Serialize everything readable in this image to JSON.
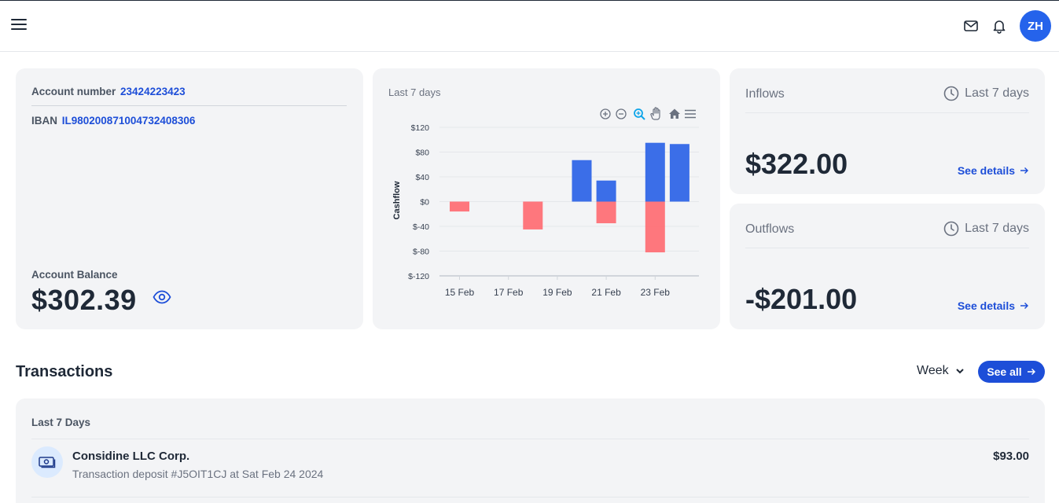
{
  "header": {
    "menu_icon": "hamburger-menu-icon",
    "mail_icon": "mail-icon",
    "bell_icon": "bell-icon",
    "avatar_initials": "ZH",
    "avatar_color": "#2563eb"
  },
  "account": {
    "number_label": "Account number",
    "number_value": "23424223423",
    "iban_label": "IBAN",
    "iban_value": "IL980200871004732408306",
    "balance_label": "Account Balance",
    "balance_value": "$302.39",
    "visibility_icon": "eye-icon"
  },
  "chart_card": {
    "title": "Last 7 days",
    "toolbar": [
      "zoom-in-icon",
      "zoom-out-icon",
      "selection-zoom-icon",
      "pan-hand-icon",
      "home-reset-icon",
      "menu-icon"
    ]
  },
  "chart_data": {
    "type": "bar",
    "ylabel": "Cashflow",
    "ylim": [
      -120,
      120
    ],
    "yticks": [
      120,
      80,
      40,
      0,
      -40,
      -80,
      -120
    ],
    "ytick_labels": [
      "$120",
      "$80",
      "$40",
      "$0",
      "$-40",
      "$-80",
      "$-120"
    ],
    "xticks": [
      "15 Feb",
      "17 Feb",
      "19 Feb",
      "21 Feb",
      "23 Feb"
    ],
    "inflow_color": "#3b6ee8",
    "outflow_color": "#ff6b72",
    "bars": [
      {
        "day": 0,
        "kind": "outflow",
        "value": -16
      },
      {
        "day": 3,
        "kind": "outflow",
        "value": -45
      },
      {
        "day": 5,
        "kind": "inflow",
        "value": 67
      },
      {
        "day": 6,
        "kind": "inflow",
        "value": 34
      },
      {
        "day": 6,
        "kind": "outflow",
        "value": -35
      },
      {
        "day": 8,
        "kind": "inflow",
        "value": 95
      },
      {
        "day": 8,
        "kind": "outflow",
        "value": -82
      },
      {
        "day": 9,
        "kind": "inflow",
        "value": 93
      }
    ]
  },
  "inflows": {
    "title": "Inflows",
    "period": "Last 7 days",
    "period_icon": "clock-icon",
    "amount": "$322.00",
    "link": "See details"
  },
  "outflows": {
    "title": "Outflows",
    "period": "Last 7 days",
    "period_icon": "clock-icon",
    "amount": "-$201.00",
    "link": "See details"
  },
  "transactions": {
    "heading": "Transactions",
    "filter_value": "Week",
    "see_all": "See all",
    "group_label": "Last 7 Days",
    "items": [
      {
        "icon": "cash-icon",
        "name": "Considine LLC Corp.",
        "description": "Transaction deposit #J5OIT1CJ at Sat Feb 24 2024",
        "amount": "$93.00"
      }
    ]
  }
}
